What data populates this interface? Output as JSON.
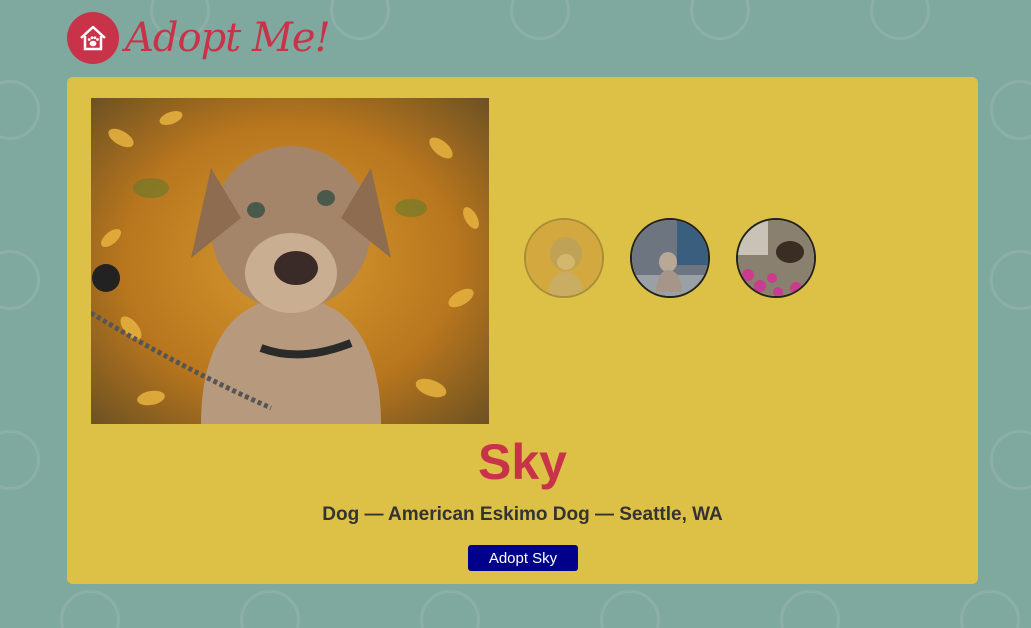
{
  "header": {
    "logo_text": "Adopt Me!",
    "logo_icon": "house-paw-icon"
  },
  "pet": {
    "name": "Sky",
    "details": "Dog — American Eskimo Dog — Seattle, WA",
    "adopt_button_label": "Adopt Sky",
    "images": [
      {
        "icon": "dog-in-leaves-photo",
        "active": true
      },
      {
        "icon": "dog-by-stream-photo",
        "active": false
      },
      {
        "icon": "dog-with-flowers-photo",
        "active": false
      }
    ]
  },
  "colors": {
    "background": "#7fa89f",
    "card": "#dcc146",
    "accent": "#c9334a",
    "button": "#00008b"
  }
}
